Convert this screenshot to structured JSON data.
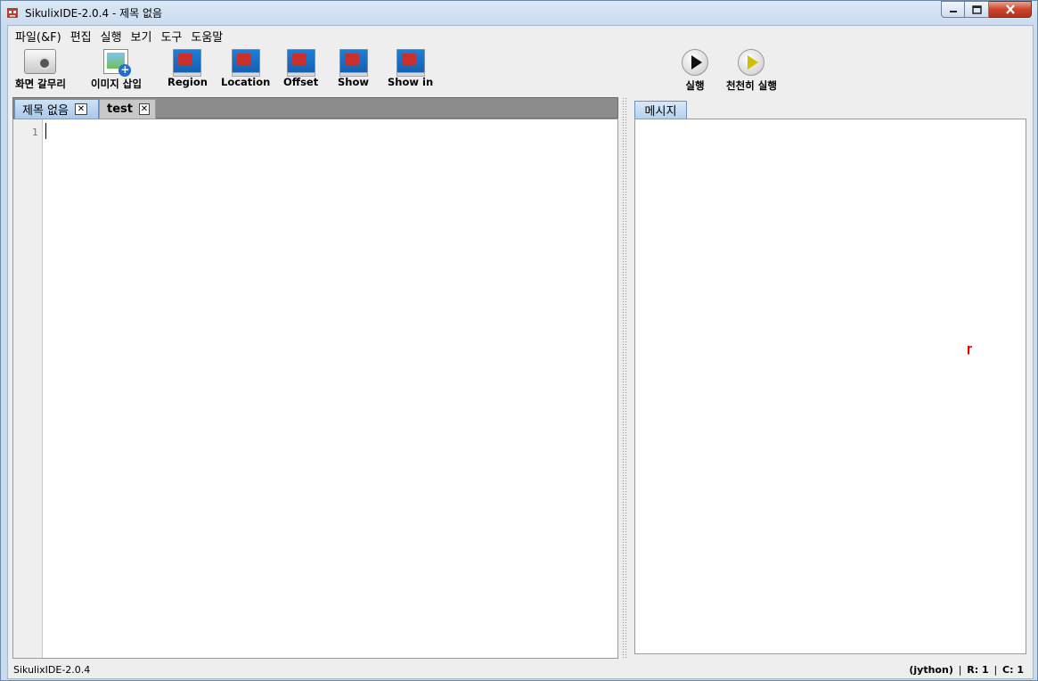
{
  "window": {
    "title": "SikulixIDE-2.0.4 - 제목 없음",
    "controls": {
      "minimize": "minimize",
      "maximize": "maximize",
      "close": "close"
    }
  },
  "menu": [
    {
      "label": "파일(&F)"
    },
    {
      "label": "편집"
    },
    {
      "label": "실행"
    },
    {
      "label": "보기"
    },
    {
      "label": "도구"
    },
    {
      "label": "도움말"
    }
  ],
  "toolbar": {
    "capture": "화면 갈무리",
    "insert_image": "이미지 삽입",
    "region": "Region",
    "location": "Location",
    "offset": "Offset",
    "show": "Show",
    "show_in": "Show in",
    "run": "실행",
    "run_slow": "천천히 실행"
  },
  "tabs": [
    {
      "label": "제목 없음",
      "close": "✕",
      "active": true
    },
    {
      "label": "test",
      "close": "✕",
      "active": false
    }
  ],
  "editor": {
    "line_number": "1"
  },
  "message_panel": {
    "tab_label": "메시지",
    "content": "ɼ"
  },
  "status": {
    "left": "SikulixIDE-2.0.4",
    "lang": "(jython)",
    "row": "R: 1",
    "col": "C: 1",
    "separator": "|"
  },
  "colors": {
    "accent_tab": "#a9c9ea",
    "close_red": "#c9462e"
  }
}
